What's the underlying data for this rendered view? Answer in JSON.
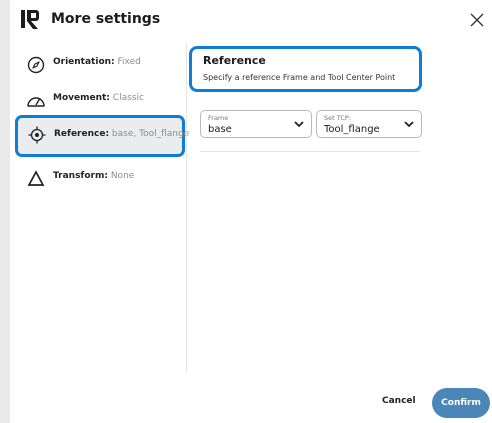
{
  "dialog": {
    "title": "More settings"
  },
  "nav": {
    "items": [
      {
        "key": "Orientation:",
        "value": "Fixed",
        "icon": "compass-icon"
      },
      {
        "key": "Movement:",
        "value": "Classic",
        "icon": "speedometer-icon"
      },
      {
        "key": "Reference:",
        "value": "base, Tool_flange",
        "icon": "target-icon"
      },
      {
        "key": "Transform:",
        "value": "None",
        "icon": "triangle-icon"
      }
    ],
    "selected_index": 2
  },
  "reference": {
    "title": "Reference",
    "subtitle": "Specify a reference Frame and Tool Center Point"
  },
  "frame_select": {
    "label": "Frame",
    "value": "base"
  },
  "tcp_select": {
    "label": "Set TCP:",
    "value": "Tool_flange"
  },
  "footer": {
    "cancel_label": "Cancel",
    "confirm_label": "Confirm"
  },
  "colors": {
    "accent": "#0d7dd6",
    "confirm": "#4a86b8",
    "muted_text": "#8c8c8c",
    "selected_bg": "#eaecef"
  }
}
